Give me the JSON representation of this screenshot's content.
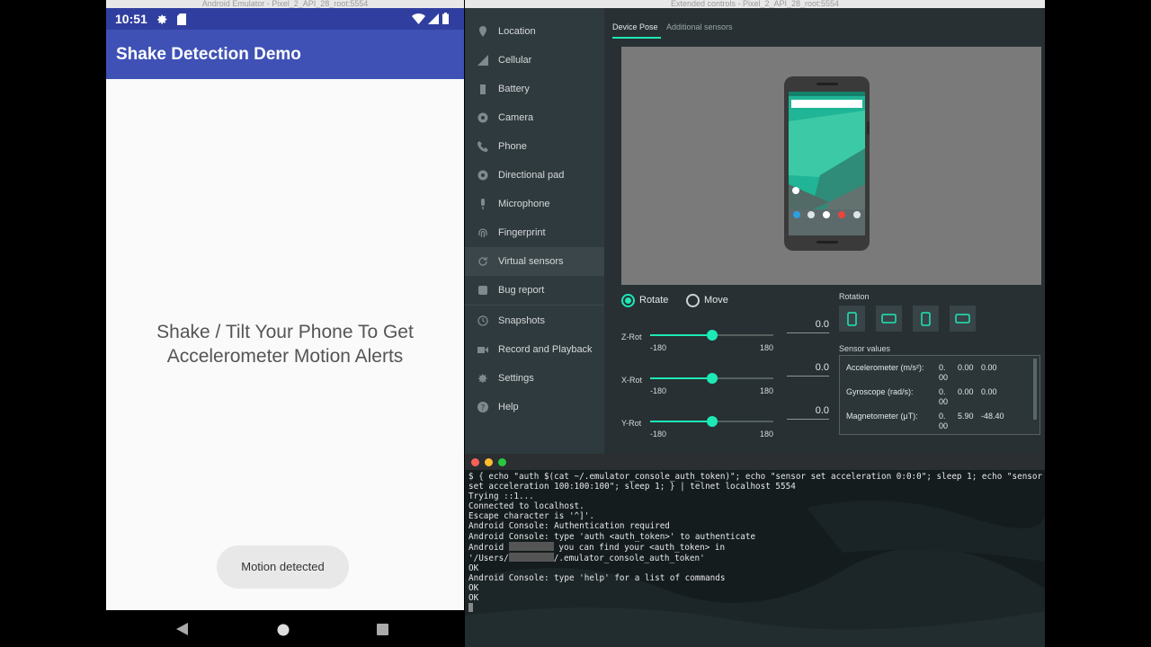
{
  "emulator": {
    "window_title": "Android Emulator - Pixel_2_API_28_root:5554",
    "status_time": "10:51",
    "app_title": "Shake Detection Demo",
    "message_line1": "Shake / Tilt Your Phone To Get",
    "message_line2": "Accelerometer Motion Alerts",
    "toast": "Motion detected",
    "status_icons": [
      "gear-icon",
      "sd-card-icon",
      "wifi-icon",
      "signal-icon",
      "battery-icon"
    ],
    "nav_icons": [
      "back-icon",
      "home-icon",
      "recents-icon"
    ]
  },
  "extended_controls": {
    "window_title": "Extended controls - Pixel_2_API_28_root:5554",
    "sidebar": [
      {
        "label": "Location",
        "icon": "location-pin-icon"
      },
      {
        "label": "Cellular",
        "icon": "signal-icon"
      },
      {
        "label": "Battery",
        "icon": "battery-icon"
      },
      {
        "label": "Camera",
        "icon": "camera-icon"
      },
      {
        "label": "Phone",
        "icon": "phone-icon"
      },
      {
        "label": "Directional pad",
        "icon": "dpad-icon"
      },
      {
        "label": "Microphone",
        "icon": "microphone-icon"
      },
      {
        "label": "Fingerprint",
        "icon": "fingerprint-icon"
      },
      {
        "label": "Virtual sensors",
        "icon": "rotate-icon"
      },
      {
        "label": "Bug report",
        "icon": "bug-icon"
      },
      {
        "label": "Snapshots",
        "icon": "history-icon"
      },
      {
        "label": "Record and Playback",
        "icon": "video-icon"
      },
      {
        "label": "Settings",
        "icon": "gear-icon"
      },
      {
        "label": "Help",
        "icon": "help-icon"
      }
    ],
    "active_item": "Virtual sensors",
    "tabs": [
      "Device Pose",
      "Additional sensors"
    ],
    "active_tab": "Device Pose",
    "mode_options": [
      "Rotate",
      "Move"
    ],
    "selected_mode": "Rotate",
    "sliders": [
      {
        "label": "Z-Rot",
        "min": "-180",
        "max": "180",
        "value": "0.0",
        "fraction": 0.5
      },
      {
        "label": "X-Rot",
        "min": "-180",
        "max": "180",
        "value": "0.0",
        "fraction": 0.5
      },
      {
        "label": "Y-Rot",
        "min": "-180",
        "max": "180",
        "value": "0.0",
        "fraction": 0.5
      }
    ],
    "rotation_label": "Rotation",
    "rotation_buttons": [
      "portrait-icon",
      "landscape-icon",
      "reverse-portrait-icon",
      "reverse-landscape-icon"
    ],
    "sensor_values_label": "Sensor values",
    "sensors": [
      {
        "name": "Accelerometer (m/s²):",
        "v1": "0.",
        "v1b": "00",
        "v2": "0.00",
        "v3": "0.00"
      },
      {
        "name": "Gyroscope (rad/s):",
        "v1": "0.",
        "v1b": "00",
        "v2": "0.00",
        "v3": "0.00"
      },
      {
        "name": "Magnetometer (μT):",
        "v1": "0.",
        "v1b": "00",
        "v2": "5.90",
        "v3": "-48.40"
      }
    ]
  },
  "terminal": {
    "lines": [
      "$ { echo \"auth $(cat ~/.emulator_console_auth_token)\"; echo \"sensor set acceleration 0:0:0\"; sleep 1; echo \"sensor",
      "set acceleration 100:100:100\"; sleep 1; } | telnet localhost 5554",
      "Trying ::1...",
      "Connected to localhost.",
      "Escape character is '^]'.",
      "Android Console: Authentication required",
      "Android Console: type 'auth <auth_token>' to authenticate",
      "Android Console: you can find your <auth_token> in",
      "'/Users/ /.emulator_console_auth_token'",
      "OK",
      "Android Console: type 'help' for a list of commands",
      "OK",
      "OK"
    ],
    "line7_prefix": "Android",
    "line7_suffix": "you can find your <auth_token> in",
    "line8_prefix": "'/Users/",
    "line8_suffix": "/.emulator_console_auth_token'"
  }
}
